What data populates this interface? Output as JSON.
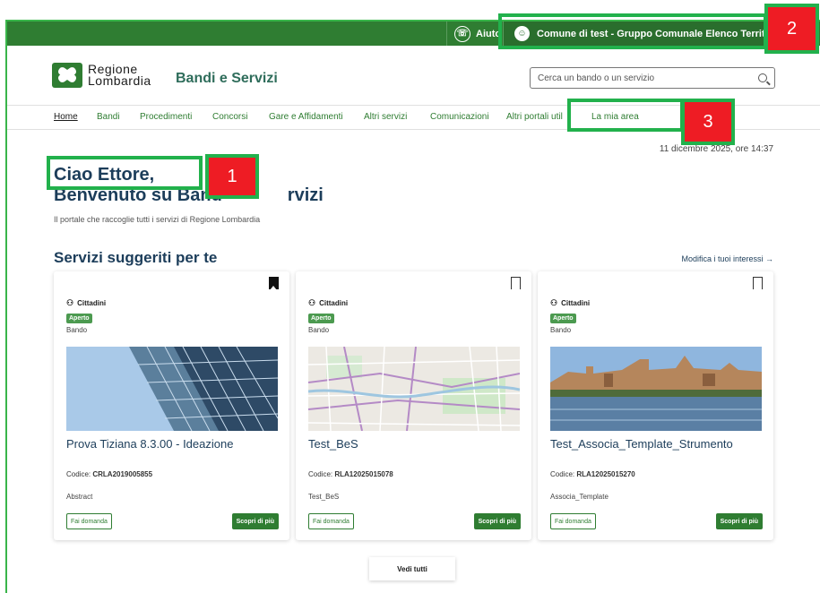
{
  "topbar": {
    "help_label": "Aiuto",
    "user_label": "Comune di test - Gruppo Comunale Elenco Territo..."
  },
  "header": {
    "logo_line1": "Regione",
    "logo_line2": "Lombardia",
    "app_title": "Bandi e Servizi",
    "search_placeholder": "Cerca un bando o un servizio"
  },
  "nav": {
    "items": [
      "Home",
      "Bandi",
      "Procedimenti",
      "Concorsi",
      "Gare e Affidamenti",
      "Altri servizi",
      "Comunicazioni",
      "Altri portali util",
      "La mia area"
    ]
  },
  "main": {
    "date_time": "11 dicembre 2025, ore 14:37",
    "greeting_line1": "Ciao Ettore,",
    "greeting_line2": "Benvenuto su Band",
    "greeting_line2_tail": "rvizi",
    "subtitle": "Il portale che raccoglie tutti i servizi di Regione Lombardia",
    "section_title": "Servizi suggeriti per te",
    "section_link": "Modifica i tuoi interessi →",
    "see_all": "Vedi tutti"
  },
  "cards": [
    {
      "category": "Cittadini",
      "status": "Aperto",
      "type": "Bando",
      "title": "Prova Tiziana 8.3.00 - Ideazione",
      "codice_label": "Codice:",
      "codice": "CRLA2019005855",
      "abstract": "Abstract",
      "apply_label": "Fai domanda",
      "more_label": "Scopri di più",
      "bookmarked": true
    },
    {
      "category": "Cittadini",
      "status": "Aperto",
      "type": "Bando",
      "title": "Test_BeS",
      "codice_label": "Codice:",
      "codice": "RLA12025015078",
      "abstract": "Test_BeS",
      "apply_label": "Fai domanda",
      "more_label": "Scopri di più",
      "bookmarked": false
    },
    {
      "category": "Cittadini",
      "status": "Aperto",
      "type": "Bando",
      "title": "Test_Associa_Template_Strumento",
      "codice_label": "Codice:",
      "codice": "RLA12025015270",
      "abstract": "Associa_Template",
      "apply_label": "Fai domanda",
      "more_label": "Scopri di più",
      "bookmarked": false
    }
  ],
  "annotations": [
    "1",
    "2",
    "3"
  ],
  "colors": {
    "brand_green": "#2f7d32",
    "heading_blue": "#1c3d5a",
    "annotation_green": "#22b14c",
    "annotation_red": "#ee1c24"
  }
}
